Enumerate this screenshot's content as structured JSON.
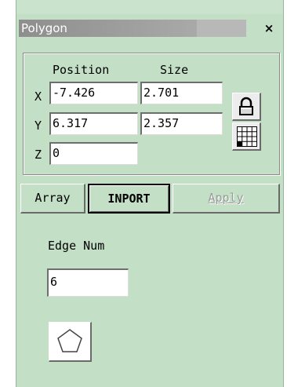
{
  "window": {
    "title": "Polygon",
    "close_label": "×"
  },
  "transform": {
    "position_header": "Position",
    "size_header": "Size",
    "rows": [
      {
        "axis": "X",
        "position": "-7.426",
        "size": "2.701"
      },
      {
        "axis": "Y",
        "position": "6.317",
        "size": "2.357"
      },
      {
        "axis": "Z",
        "position": "0"
      }
    ],
    "icons": [
      "lock-icon",
      "grid-anchor-icon"
    ]
  },
  "actions": {
    "array_label": "Array",
    "inport_label": "INPORT",
    "apply_label": "Apply"
  },
  "edge": {
    "label": "Edge Num",
    "value": "6"
  },
  "shape": {
    "icon": "pentagon-icon"
  },
  "colors": {
    "panel_bg": "#c3e0c7",
    "title_bar": "#8e8e8e",
    "disabled_text": "#9a9a9a"
  }
}
